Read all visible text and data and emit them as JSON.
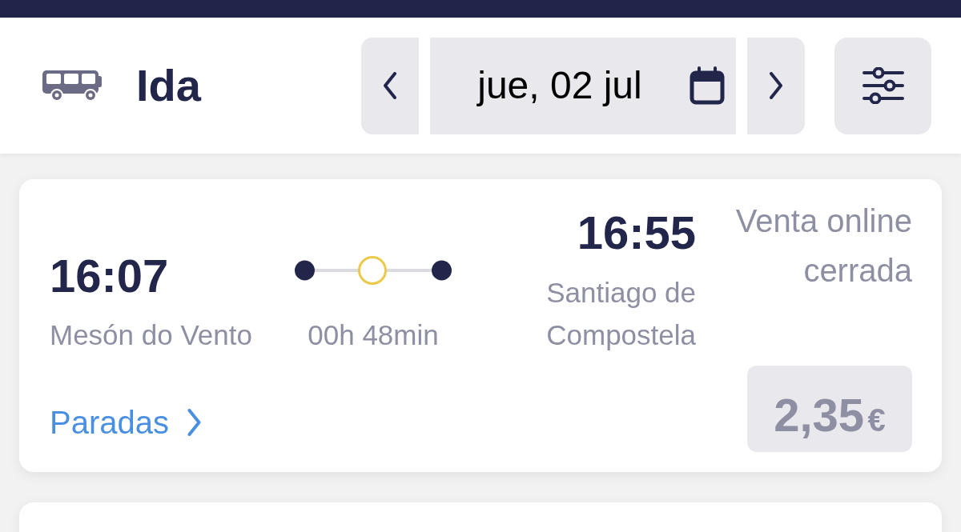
{
  "header": {
    "title": "Ida",
    "date": "jue, 02 jul"
  },
  "trips": [
    {
      "departure": {
        "time": "16:07",
        "stop": "Mesón do Vento"
      },
      "duration": "00h 48min",
      "arrival": {
        "time": "16:55",
        "stop": "Santiago de Compostela"
      },
      "status": "Venta online cerrada",
      "price": {
        "amount": "2,35",
        "currency": "€",
        "disabled": true
      },
      "stops_link": "Paradas"
    }
  ]
}
